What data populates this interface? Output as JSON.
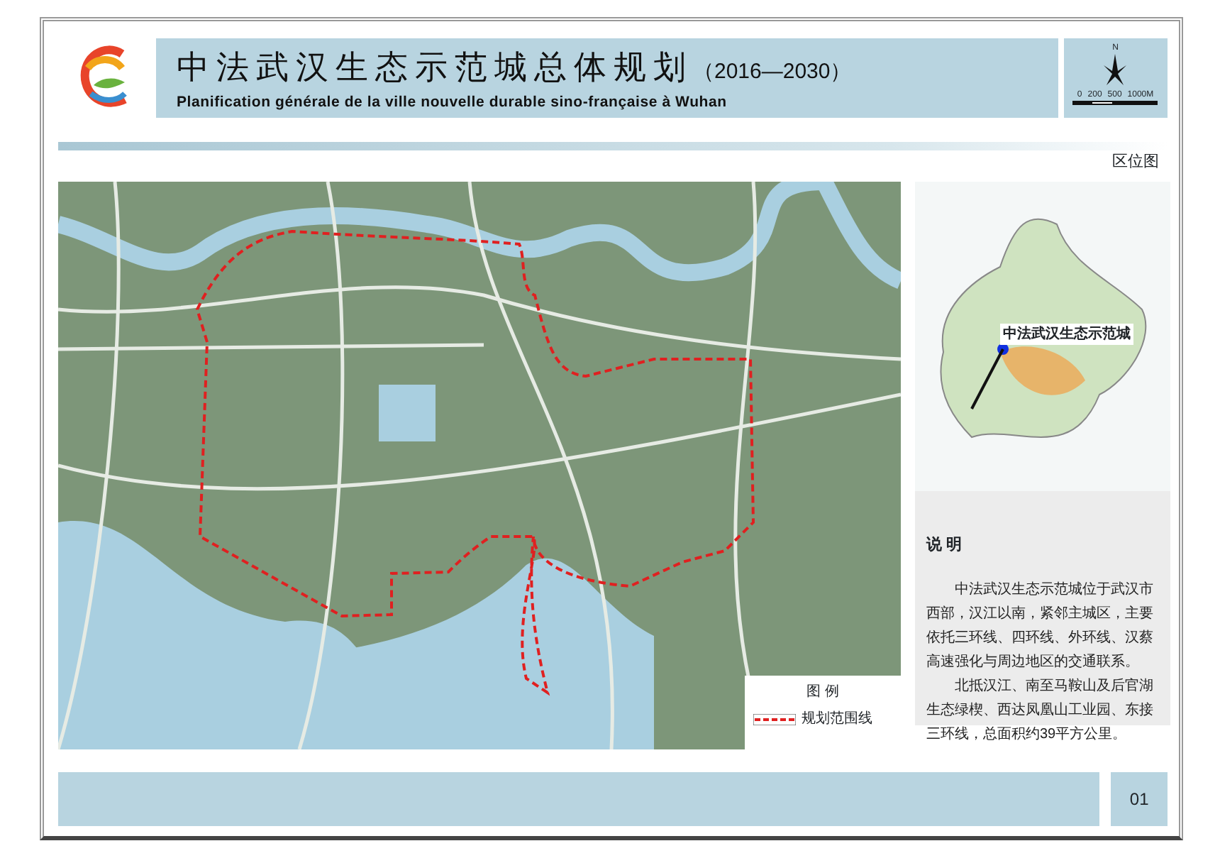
{
  "title": {
    "chinese": "中法武汉生态示范城总体规划",
    "years": "（2016—2030）",
    "french": "Planification générale de la ville nouvelle durable sino-française à Wuhan"
  },
  "north_arrow": {
    "label": "N",
    "scale_ticks": [
      "0",
      "200",
      "500",
      "1000M"
    ]
  },
  "section_label": "区位图",
  "map": {
    "legend": {
      "title": "图 例",
      "items": [
        {
          "label": "规划范围线",
          "color": "#e02020"
        }
      ]
    }
  },
  "location_map": {
    "callout": "中法武汉生态示范城"
  },
  "description": {
    "heading": "说 明",
    "paragraphs": [
      "中法武汉生态示范城位于武汉市西部，汉江以南，紧邻主城区，主要依托三环线、四环线、外环线、汉蔡高速强化与周边地区的交通联系。",
      "北抵汉江、南至马鞍山及后官湖生态绿楔、西达凤凰山工业园、东接三环线，总面积约39平方公里。"
    ]
  },
  "page_number": "01"
}
